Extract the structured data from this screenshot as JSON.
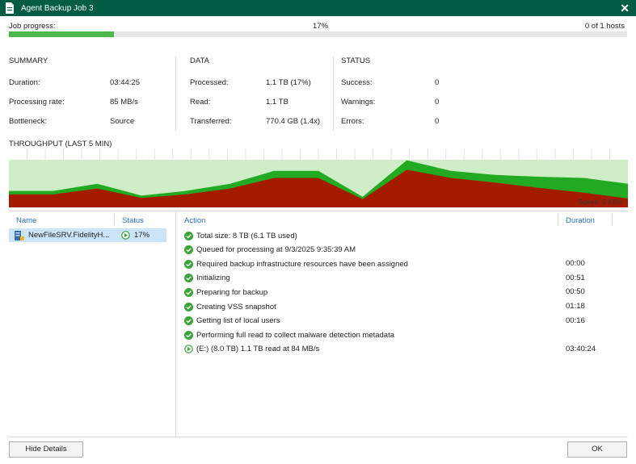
{
  "window": {
    "title": "Agent Backup Job 3",
    "close_glyph": "✕"
  },
  "progress": {
    "label": "Job progress:",
    "percent_text": "17%",
    "percent": 17,
    "hosts_text": "0 of 1 hosts"
  },
  "summary": {
    "title": "SUMMARY",
    "rows": [
      {
        "label": "Duration:",
        "value": "03:44:25"
      },
      {
        "label": "Processing rate:",
        "value": "85 MB/s"
      },
      {
        "label": "Bottleneck:",
        "value": "Source"
      }
    ]
  },
  "data": {
    "title": "DATA",
    "rows": [
      {
        "label": "Processed:",
        "value": "1.1 TB (17%)"
      },
      {
        "label": "Read:",
        "value": "1.1 TB"
      },
      {
        "label": "Transferred:",
        "value": "770.4 GB (1.4x)"
      }
    ]
  },
  "status": {
    "title": "STATUS",
    "rows": [
      {
        "label": "Success:",
        "value": "0"
      },
      {
        "label": "Warnings:",
        "value": "0"
      },
      {
        "label": "Errors:",
        "value": "0"
      }
    ]
  },
  "throughput": {
    "title": "THROUGHPUT (LAST 5 MIN)",
    "speed_text": "Speed: 0 KB/s",
    "colors": {
      "processed": "#22aa22",
      "read": "#a31c00",
      "bg": "#cfeec8",
      "grid": "#e4e4e4"
    },
    "processed_series": [
      0.28,
      0.28,
      0.4,
      0.2,
      0.28,
      0.4,
      0.62,
      0.62,
      0.18,
      0.8,
      0.62,
      0.55,
      0.52,
      0.5,
      0.4
    ],
    "read_series": [
      0.22,
      0.22,
      0.32,
      0.16,
      0.22,
      0.32,
      0.5,
      0.5,
      0.14,
      0.64,
      0.5,
      0.42,
      0.33,
      0.25,
      0.15
    ]
  },
  "hosts_list": {
    "columns": [
      "Name",
      "Status"
    ],
    "rows": [
      {
        "name": "NewFileSRV.FidelityH...",
        "status": "17%",
        "selected": true
      }
    ]
  },
  "actions_list": {
    "columns": [
      "Action",
      "Duration"
    ],
    "rows": [
      {
        "text": "Total size: 8 TB (6.1 TB used)",
        "duration": "",
        "icon": "success-icon"
      },
      {
        "text": "Queued for processing at 9/3/2025 9:35:39 AM",
        "duration": "",
        "icon": "success-icon"
      },
      {
        "text": "Required backup infrastructure resources have been assigned",
        "duration": "00:00",
        "icon": "success-icon"
      },
      {
        "text": "Initializing",
        "duration": "00:51",
        "icon": "success-icon"
      },
      {
        "text": "Preparing for backup",
        "duration": "00:50",
        "icon": "success-icon"
      },
      {
        "text": "Creating VSS snapshot",
        "duration": "01:18",
        "icon": "success-icon"
      },
      {
        "text": "Getting list of local users",
        "duration": "00:16",
        "icon": "success-icon"
      },
      {
        "text": "Performing full read to collect malware detection metadata",
        "duration": "",
        "icon": "success-icon"
      },
      {
        "text": "(E:) (8.0 TB) 1.1 TB read at 84 MB/s",
        "duration": "03:40:24",
        "icon": "running-icon"
      }
    ]
  },
  "buttons": {
    "hide_details": "Hide Details",
    "ok": "OK"
  }
}
